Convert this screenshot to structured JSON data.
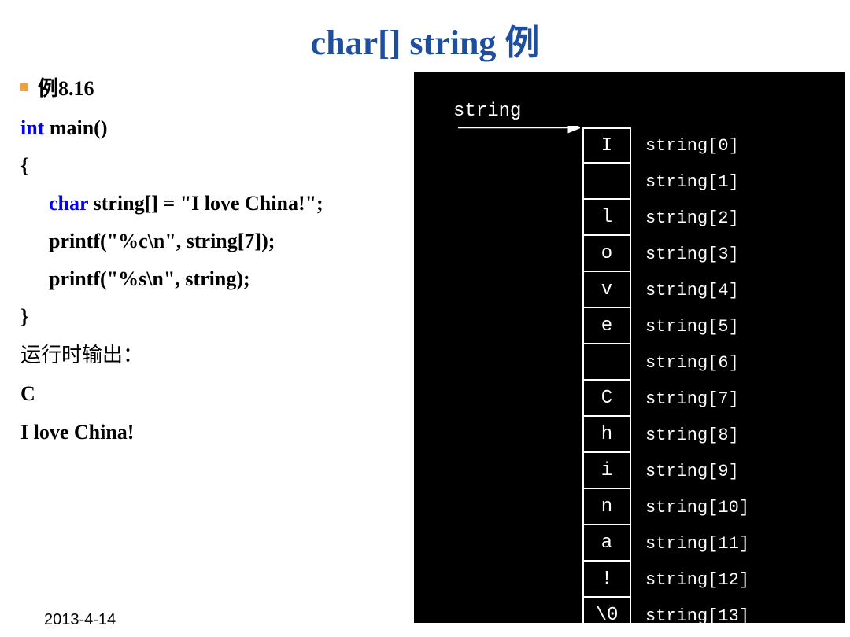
{
  "title": "char[] string 例",
  "bullet": "例8.16",
  "code": {
    "l1_kw": "int",
    "l1_rest": " main()",
    "l2": "{",
    "l3_kw": "char",
    "l3_rest": " string[] = \"I love China!\";",
    "l4": "printf(\"%c\\n\", string[7]);",
    "l5": "printf(\"%s\\n\", string);",
    "l6": "}"
  },
  "output_label": "运行时输出：",
  "output": {
    "l1": "C",
    "l2": "I love China!"
  },
  "diagram": {
    "label": "string",
    "cells": [
      {
        "char": "I",
        "label": "string[0]"
      },
      {
        "char": " ",
        "label": "string[1]"
      },
      {
        "char": "l",
        "label": "string[2]"
      },
      {
        "char": "o",
        "label": "string[3]"
      },
      {
        "char": "v",
        "label": "string[4]"
      },
      {
        "char": "e",
        "label": "string[5]"
      },
      {
        "char": " ",
        "label": "string[6]"
      },
      {
        "char": "C",
        "label": "string[7]"
      },
      {
        "char": "h",
        "label": "string[8]"
      },
      {
        "char": "i",
        "label": "string[9]"
      },
      {
        "char": "n",
        "label": "string[10]"
      },
      {
        "char": "a",
        "label": "string[11]"
      },
      {
        "char": "!",
        "label": "string[12]"
      },
      {
        "char": "\\0",
        "label": "string[13]"
      }
    ]
  },
  "date": "2013-4-14"
}
